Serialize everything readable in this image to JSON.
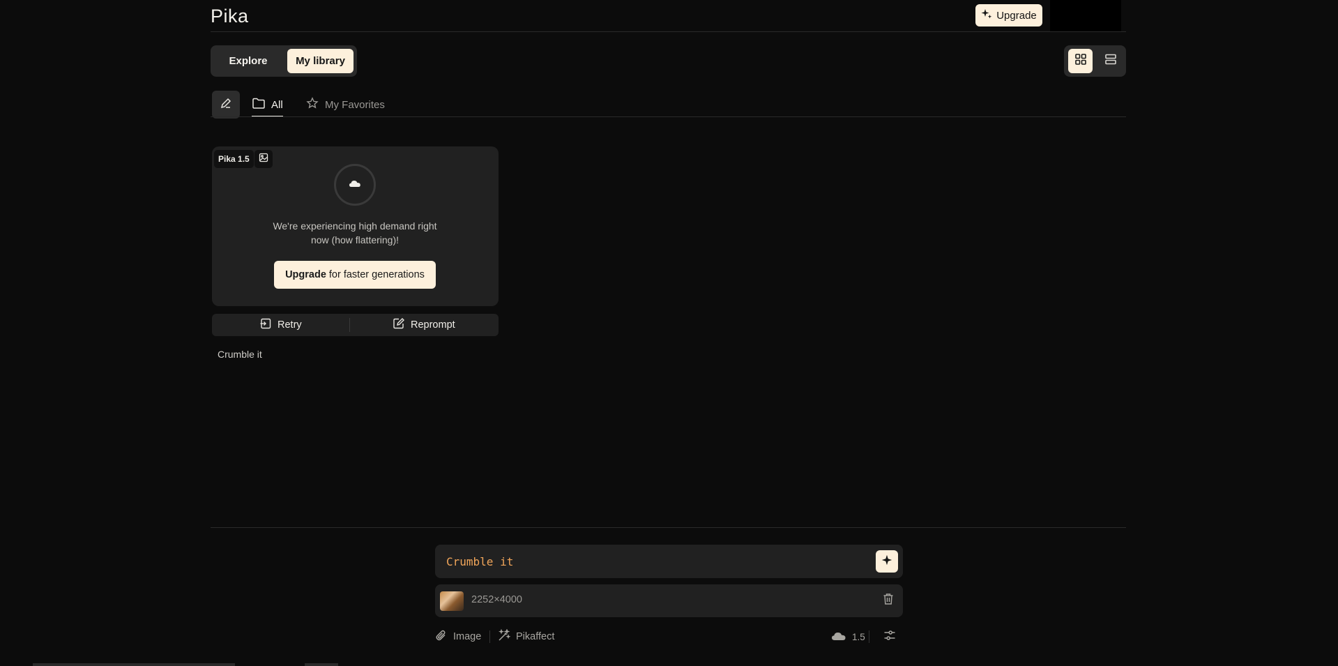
{
  "header": {
    "logo": "Pika",
    "upgrade_label": "Upgrade"
  },
  "nav": {
    "explore_label": "Explore",
    "library_label": "My library",
    "active": "My library"
  },
  "view_toggle": {
    "grid_icon": "grid-icon",
    "list_icon": "list-icon",
    "active": "grid"
  },
  "filters": {
    "all_label": "All",
    "favorites_label": "My Favorites",
    "active": "All"
  },
  "card": {
    "model_badge": "Pika 1.5",
    "message": "We're experiencing high demand right now (how flattering)!",
    "upgrade_bold": "Upgrade",
    "upgrade_rest": "for faster generations",
    "retry_label": "Retry",
    "reprompt_label": "Reprompt",
    "prompt_caption": "Crumble it"
  },
  "composer": {
    "prompt_value": "Crumble it",
    "attachment_dims": "2252×4000",
    "image_label": "Image",
    "pikaffect_label": "Pikaffect",
    "model_version": "1.5"
  },
  "colors": {
    "background": "#0c0c0c",
    "accent_cream": "#fdf0dc",
    "prompt_orange": "#f2a65a"
  }
}
